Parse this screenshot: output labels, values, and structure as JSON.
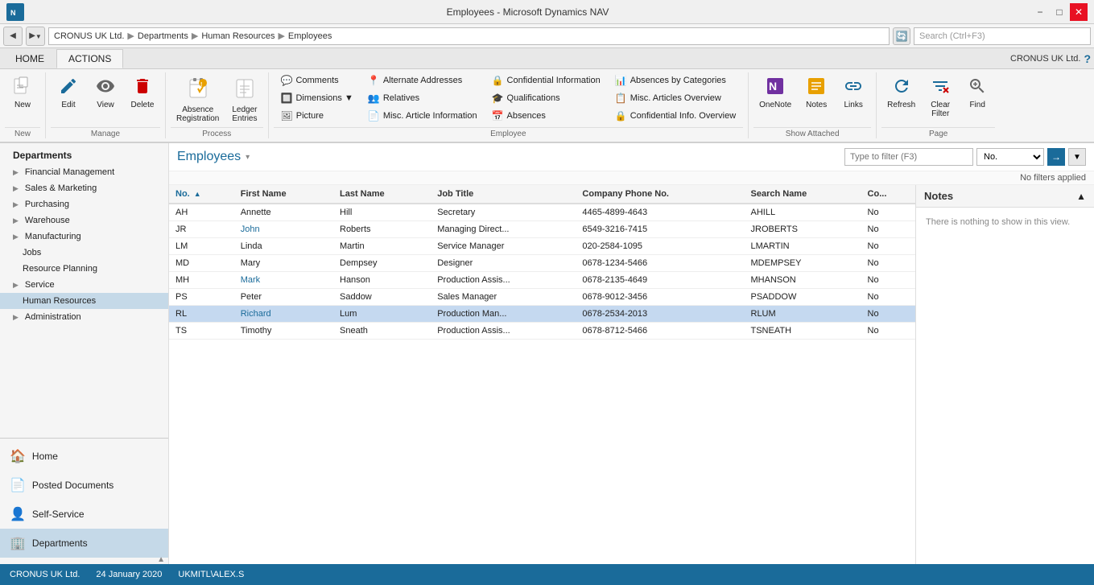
{
  "titleBar": {
    "title": "Employees - Microsoft Dynamics NAV",
    "appIcon": "NAV",
    "winControls": [
      "−",
      "□",
      "✕"
    ]
  },
  "addressBar": {
    "back": "◀",
    "forward": "▶",
    "path": [
      "CRONUS UK Ltd.",
      "Departments",
      "Human Resources",
      "Employees"
    ],
    "searchPlaceholder": "Search (Ctrl+F3)"
  },
  "ribbon": {
    "tabs": [
      "HOME",
      "ACTIONS"
    ],
    "activeTab": "HOME",
    "companyName": "CRONUS UK Ltd.",
    "groups": {
      "new": {
        "label": "New",
        "buttons": [
          {
            "icon": "📄",
            "label": "New"
          }
        ]
      },
      "manage": {
        "label": "Manage",
        "buttons": [
          {
            "icon": "✏️",
            "label": "Edit"
          },
          {
            "icon": "👁",
            "label": "View"
          },
          {
            "icon": "🗑",
            "label": "Delete"
          }
        ]
      },
      "process": {
        "label": "Process",
        "buttons": [
          {
            "icon": "⚠️",
            "label": "Absence\nRegistration"
          },
          {
            "icon": "📋",
            "label": "Ledger\nEntries"
          }
        ]
      },
      "employee": {
        "label": "Employee",
        "cols": [
          [
            {
              "icon": "💬",
              "label": "Comments"
            },
            {
              "icon": "🔲",
              "label": "Dimensions"
            },
            {
              "icon": "🖼",
              "label": "Picture"
            }
          ],
          [
            {
              "icon": "📍",
              "label": "Alternate Addresses"
            },
            {
              "icon": "👥",
              "label": "Relatives"
            },
            {
              "icon": "📄",
              "label": "Misc. Article Information"
            }
          ],
          [
            {
              "icon": "🔒",
              "label": "Confidential Information"
            },
            {
              "icon": "🎓",
              "label": "Qualifications"
            },
            {
              "icon": "📅",
              "label": "Absences"
            }
          ],
          [
            {
              "icon": "📊",
              "label": "Absences by Categories"
            },
            {
              "icon": "📋",
              "label": "Misc. Articles Overview"
            },
            {
              "icon": "🔒",
              "label": "Confidential Info. Overview"
            }
          ]
        ]
      },
      "showAttached": {
        "label": "Show Attached",
        "buttons": [
          {
            "icon": "📓",
            "label": "OneNote"
          },
          {
            "icon": "📝",
            "label": "Notes"
          },
          {
            "icon": "🔗",
            "label": "Links"
          }
        ]
      },
      "page": {
        "label": "Page",
        "buttons": [
          {
            "icon": "🔄",
            "label": "Refresh"
          },
          {
            "icon": "🔽",
            "label": "Clear\nFilter"
          },
          {
            "icon": "🔍",
            "label": "Find"
          }
        ]
      }
    }
  },
  "sidebar": {
    "navItems": [
      {
        "label": "Departments",
        "level": 0,
        "expandable": false
      },
      {
        "label": "Financial Management",
        "level": 0,
        "expandable": true
      },
      {
        "label": "Sales & Marketing",
        "level": 0,
        "expandable": true
      },
      {
        "label": "Purchasing",
        "level": 0,
        "expandable": true
      },
      {
        "label": "Warehouse",
        "level": 0,
        "expandable": true
      },
      {
        "label": "Manufacturing",
        "level": 0,
        "expandable": true
      },
      {
        "label": "Jobs",
        "level": 1,
        "expandable": false
      },
      {
        "label": "Resource Planning",
        "level": 1,
        "expandable": false
      },
      {
        "label": "Service",
        "level": 0,
        "expandable": true
      },
      {
        "label": "Human Resources",
        "level": 1,
        "expandable": false,
        "selected": true
      },
      {
        "label": "Administration",
        "level": 0,
        "expandable": true
      }
    ],
    "bottomItems": [
      {
        "icon": "🏠",
        "label": "Home"
      },
      {
        "icon": "📄",
        "label": "Posted Documents"
      },
      {
        "icon": "👤",
        "label": "Self-Service"
      },
      {
        "icon": "🏢",
        "label": "Departments",
        "selected": true
      }
    ]
  },
  "employeeList": {
    "title": "Employees",
    "filterPlaceholder": "Type to filter (F3)",
    "filterField": "No.",
    "noFilters": "No filters applied",
    "columns": [
      {
        "key": "no",
        "label": "No.",
        "sorted": true
      },
      {
        "key": "firstName",
        "label": "First Name"
      },
      {
        "key": "lastName",
        "label": "Last Name"
      },
      {
        "key": "jobTitle",
        "label": "Job Title"
      },
      {
        "key": "companyPhone",
        "label": "Company Phone No."
      },
      {
        "key": "searchName",
        "label": "Search Name"
      },
      {
        "key": "co",
        "label": "Co..."
      }
    ],
    "rows": [
      {
        "no": "AH",
        "firstName": "Annette",
        "lastName": "Hill",
        "jobTitle": "Secretary",
        "companyPhone": "4465-4899-4643",
        "searchName": "AHILL",
        "co": "No"
      },
      {
        "no": "JR",
        "firstName": "John",
        "lastName": "Roberts",
        "jobTitle": "Managing Direct...",
        "companyPhone": "6549-3216-7415",
        "searchName": "JROBERTS",
        "co": "No"
      },
      {
        "no": "LM",
        "firstName": "Linda",
        "lastName": "Martin",
        "jobTitle": "Service Manager",
        "companyPhone": "020-2584-1095",
        "searchName": "LMARTIN",
        "co": "No"
      },
      {
        "no": "MD",
        "firstName": "Mary",
        "lastName": "Dempsey",
        "jobTitle": "Designer",
        "companyPhone": "0678-1234-5466",
        "searchName": "MDEMPSEY",
        "co": "No"
      },
      {
        "no": "MH",
        "firstName": "Mark",
        "lastName": "Hanson",
        "jobTitle": "Production Assis...",
        "companyPhone": "0678-2135-4649",
        "searchName": "MHANSON",
        "co": "No"
      },
      {
        "no": "PS",
        "firstName": "Peter",
        "lastName": "Saddow",
        "jobTitle": "Sales Manager",
        "companyPhone": "0678-9012-3456",
        "searchName": "PSADDOW",
        "co": "No"
      },
      {
        "no": "RL",
        "firstName": "Richard",
        "lastName": "Lum",
        "jobTitle": "Production Man...",
        "companyPhone": "0678-2534-2013",
        "searchName": "RLUM",
        "co": "No",
        "selected": true
      },
      {
        "no": "TS",
        "firstName": "Timothy",
        "lastName": "Sneath",
        "jobTitle": "Production Assis...",
        "companyPhone": "0678-8712-5466",
        "searchName": "TSNEATH",
        "co": "No"
      }
    ]
  },
  "notes": {
    "title": "Notes",
    "emptyMessage": "There is nothing to show in this view."
  },
  "statusBar": {
    "company": "CRONUS UK Ltd.",
    "date": "24 January 2020",
    "user": "UKMITL\\ALEX.S"
  }
}
